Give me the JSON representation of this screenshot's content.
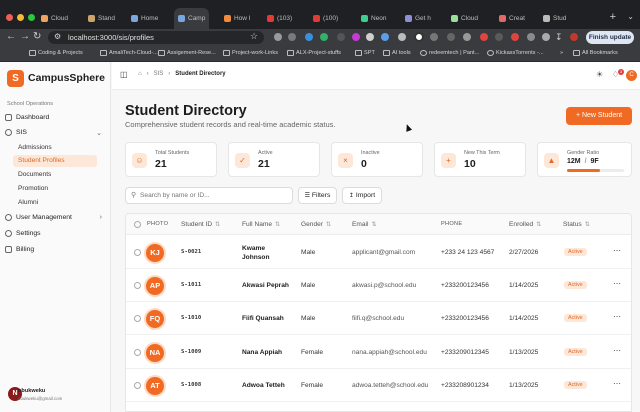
{
  "browser": {
    "tabs": [
      {
        "label": "Cloud",
        "color": "#f0a35a"
      },
      {
        "label": "Stand",
        "color": "#c9a46b"
      },
      {
        "label": "Home",
        "color": "#7aa7e0"
      },
      {
        "label": "Camp",
        "color": "#7aa7e0"
      },
      {
        "label": "How I",
        "color": "#f28b3b"
      },
      {
        "label": "(103)",
        "color": "#e53935"
      },
      {
        "label": "(100)",
        "color": "#e53935"
      },
      {
        "label": "Neon",
        "color": "#3ccf91"
      },
      {
        "label": "Get h",
        "color": "#8f8fd8"
      },
      {
        "label": "Cloud",
        "color": "#9adf9a"
      },
      {
        "label": "Creat",
        "color": "#e06a6a"
      },
      {
        "label": "Stud",
        "color": "#bbbbbb"
      }
    ],
    "url": "localhost:3000/sis/profiles",
    "finish_update": "Finish update",
    "bookmarks": [
      "Coding & Projects",
      "AmaliTech-Cloud-...",
      "Assigement-Rese...",
      "Project-work-Links",
      "ALX-Project-stuffs",
      "SPT",
      "AI tools",
      "redeemtech | Pant...",
      "KickassTorrents -..."
    ],
    "all_bookmarks": "All Bookmarks"
  },
  "sidebar": {
    "logo_letter": "S",
    "brand": "CampusSphere",
    "section": "School Operations",
    "dashboard": "Dashboard",
    "sis": "SIS",
    "sis_items": [
      "Admissions",
      "Student Profiles",
      "Documents",
      "Promotion",
      "Alumni"
    ],
    "user_management": "User Management",
    "settings": "Settings",
    "billing": "Billing",
    "user": {
      "initial": "N",
      "name": "obukweku",
      "email": "obukweku@gmail.com"
    }
  },
  "topbar": {
    "crumb_1": "SIS",
    "crumb_2": "Student Directory",
    "notif_count": "3",
    "avatar_initial": "C"
  },
  "header": {
    "title": "Student Directory",
    "subtitle": "Comprehensive student records and real-time academic status.",
    "new_button": "+ New Student"
  },
  "stats": [
    {
      "label": "Total Students",
      "value": "21"
    },
    {
      "label": "Active",
      "value": "21"
    },
    {
      "label": "Inactive",
      "value": "0"
    },
    {
      "label": "New This Term",
      "value": "10"
    }
  ],
  "gender_ratio": {
    "label": "Gender Ratio",
    "male": "12M",
    "sep": "/",
    "female": "9F",
    "male_fraction": 0.571
  },
  "toolbar": {
    "search_placeholder": "Search by name or ID...",
    "filters": "Filters",
    "import": "Import"
  },
  "table": {
    "headers": {
      "photo": "PHOTO",
      "id": "Student ID",
      "name": "Full Name",
      "gender": "Gender",
      "email": "Email",
      "phone": "PHONE",
      "enrolled": "Enrolled",
      "status": "Status"
    },
    "rows": [
      {
        "initials": "KJ",
        "id": "S-0021",
        "name": "Kwame Johnson",
        "gender": "Male",
        "email": "applicant@gmail.com",
        "phone": "+233 24 123 4567",
        "enrolled": "2/27/2026",
        "status": "Active"
      },
      {
        "initials": "AP",
        "id": "S-1011",
        "name": "Akwasi Peprah",
        "gender": "Male",
        "email": "akwasi.p@school.edu",
        "phone": "+233200123456",
        "enrolled": "1/14/2025",
        "status": "Active"
      },
      {
        "initials": "FQ",
        "id": "S-1010",
        "name": "Fiifi Quansah",
        "gender": "Male",
        "email": "fiifi.q@school.edu",
        "phone": "+233200123456",
        "enrolled": "1/14/2025",
        "status": "Active"
      },
      {
        "initials": "NA",
        "id": "S-1009",
        "name": "Nana Appiah",
        "gender": "Female",
        "email": "nana.appiah@school.edu",
        "phone": "+233209012345",
        "enrolled": "1/13/2025",
        "status": "Active"
      },
      {
        "initials": "AT",
        "id": "S-1008",
        "name": "Adwoa Tetteh",
        "gender": "Female",
        "email": "adwoa.tetteh@school.edu",
        "phone": "+233208901234",
        "enrolled": "1/13/2025",
        "status": "Active"
      }
    ]
  }
}
